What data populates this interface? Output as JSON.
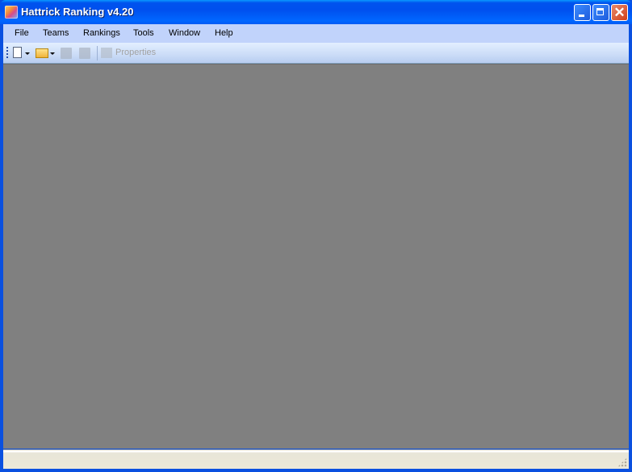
{
  "window": {
    "title": "Hattrick Ranking v4.20",
    "controls": [
      "minimize",
      "maximize",
      "close"
    ],
    "close_glyph": "✕"
  },
  "menubar": {
    "items": [
      {
        "label": "File"
      },
      {
        "label": "Teams"
      },
      {
        "label": "Rankings"
      },
      {
        "label": "Tools"
      },
      {
        "label": "Window"
      },
      {
        "label": "Help"
      }
    ]
  },
  "toolbar": {
    "buttons": [
      {
        "name": "new",
        "icon": "new-document-icon",
        "has_dropdown": true,
        "enabled": true
      },
      {
        "name": "open",
        "icon": "open-folder-icon",
        "has_dropdown": true,
        "enabled": true
      },
      {
        "name": "save",
        "icon": "save-icon",
        "enabled": false
      },
      {
        "name": "save-all",
        "icon": "save-all-icon",
        "enabled": false
      },
      {
        "name": "properties",
        "icon": "properties-icon",
        "enabled": false
      }
    ],
    "properties_label": "Properties"
  },
  "statusbar": {
    "text": ""
  }
}
